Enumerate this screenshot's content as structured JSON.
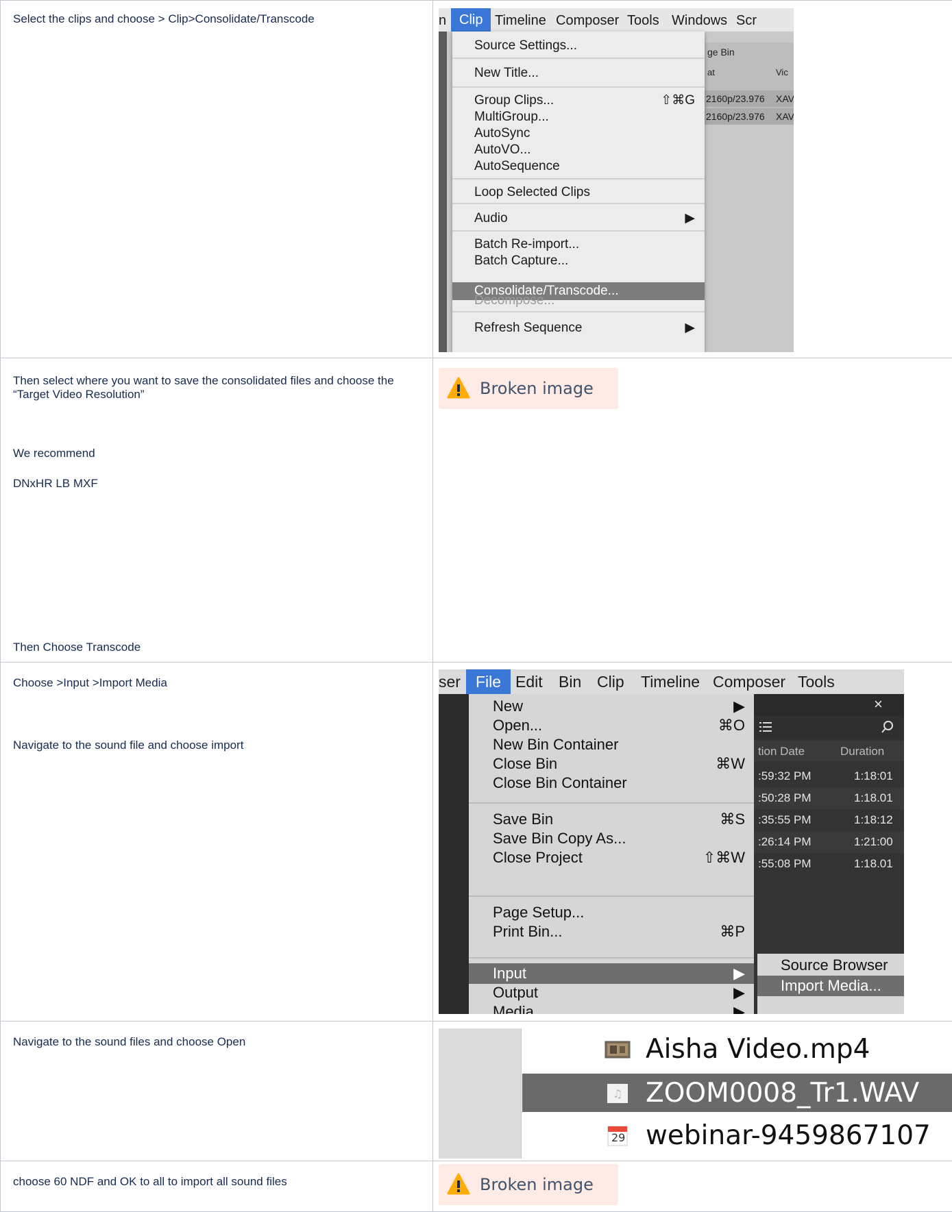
{
  "rows": [
    {
      "text": "Select the clips and choose > Clip>Consolidate/Transcode"
    },
    {
      "text1": "Then select where you want to save the consolidated files and choose the “Target Video Resolution”",
      "text2": "We recommend",
      "text3": "DNxHR LB MXF",
      "text4": "Then Choose Transcode"
    },
    {
      "text1": "Choose >Input >Import Media",
      "text2": "Navigate to the sound file and choose import"
    },
    {
      "text": "Navigate to the sound files and choose Open"
    },
    {
      "text": "choose 60 NDF and OK to all to import all sound files"
    }
  ],
  "broken_image_label": "Broken image",
  "clip_menu": {
    "menubar": [
      "n",
      "Clip",
      "Timeline",
      "Composer",
      "Tools",
      "Windows",
      "Scr"
    ],
    "active": "Clip",
    "bin_title": "ge Bin",
    "bin_col1": "at",
    "bin_col2": "Vic",
    "bin_rows": [
      {
        "format": "2160p/23.976",
        "codec": "XAV"
      },
      {
        "format": "2160p/23.976",
        "codec": "XAV"
      }
    ],
    "items": [
      {
        "label": "Source Settings...",
        "shortcut": ""
      },
      {
        "label": "New Title...",
        "shortcut": ""
      },
      {
        "label": "Group Clips...",
        "shortcut": "⇧⌘G"
      },
      {
        "label": "MultiGroup...",
        "shortcut": ""
      },
      {
        "label": "AutoSync",
        "shortcut": ""
      },
      {
        "label": "AutoVO...",
        "shortcut": ""
      },
      {
        "label": "AutoSequence",
        "shortcut": ""
      },
      {
        "label": "Loop Selected Clips",
        "shortcut": ""
      },
      {
        "label": "Audio",
        "shortcut": "▶"
      },
      {
        "label": "Batch Re-import...",
        "shortcut": ""
      },
      {
        "label": "Batch Capture...",
        "shortcut": ""
      },
      {
        "label": "Consolidate/Transcode...",
        "shortcut": ""
      },
      {
        "label": "Decompose...",
        "shortcut": ""
      },
      {
        "label": "Refresh Sequence",
        "shortcut": "▶"
      }
    ]
  },
  "file_menu": {
    "menubar": [
      "ser",
      "File",
      "Edit",
      "Bin",
      "Clip",
      "Timeline",
      "Composer",
      "Tools"
    ],
    "active": "File",
    "items": [
      {
        "label": "New",
        "shortcut": "▶"
      },
      {
        "label": "Open...",
        "shortcut": "⌘O"
      },
      {
        "label": "New Bin Container",
        "shortcut": ""
      },
      {
        "label": "Close Bin",
        "shortcut": "⌘W"
      },
      {
        "label": "Close Bin Container",
        "shortcut": ""
      },
      {
        "label": "Save Bin",
        "shortcut": "⌘S"
      },
      {
        "label": "Save Bin Copy As...",
        "shortcut": ""
      },
      {
        "label": "Close Project",
        "shortcut": "⇧⌘W"
      },
      {
        "label": "Page Setup...",
        "shortcut": ""
      },
      {
        "label": "Print Bin...",
        "shortcut": "⌘P"
      },
      {
        "label": "Input",
        "shortcut": "▶"
      },
      {
        "label": "Output",
        "shortcut": "▶"
      },
      {
        "label": "Media",
        "shortcut": "▶"
      }
    ],
    "bin_headers": [
      "tion Date",
      "Duration"
    ],
    "bin_rows": [
      {
        "date": ":59:32 PM",
        "duration": "1:18:01"
      },
      {
        "date": ":50:28 PM",
        "duration": "1:18.01"
      },
      {
        "date": ":35:55 PM",
        "duration": "1:18:12"
      },
      {
        "date": ":26:14 PM",
        "duration": "1:21:00"
      },
      {
        "date": ":55:08 PM",
        "duration": "1:18.01"
      }
    ],
    "close_glyph": "×",
    "submenu": [
      "Source Browser",
      "Import Media..."
    ]
  },
  "finder": {
    "files": [
      "Aisha Video.mp4",
      "ZOOM0008_Tr1.WAV",
      "webinar-9459867107"
    ],
    "selected_index": 1,
    "calendar_day": "29"
  },
  "colors": {
    "menu_highlight": "#3b77d6",
    "broken_bg": "#ffebe6",
    "warning": "#ffab00",
    "border": "#c1c7d0"
  }
}
